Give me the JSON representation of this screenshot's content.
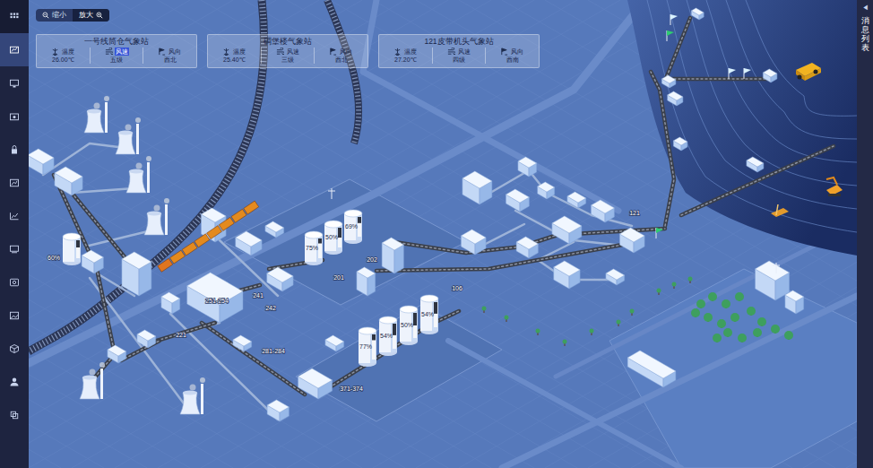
{
  "zoom_controls": [
    {
      "label": "缩小",
      "selected": false
    },
    {
      "label": "放大",
      "selected": true
    }
  ],
  "sidebar": {
    "items": [
      {
        "selected": false
      },
      {
        "selected": true
      },
      {
        "selected": false
      },
      {
        "selected": false
      },
      {
        "selected": false
      },
      {
        "selected": false
      },
      {
        "selected": false
      },
      {
        "selected": false
      },
      {
        "selected": false
      },
      {
        "selected": false
      },
      {
        "selected": false
      },
      {
        "selected": false
      },
      {
        "selected": false
      }
    ]
  },
  "weather_stations": [
    {
      "title": "一号线筒仓气象站",
      "metrics": [
        {
          "label": "温度",
          "value": "26.00℃",
          "highlighted": false
        },
        {
          "label": "风速",
          "value": "五级",
          "highlighted": true
        },
        {
          "label": "风向",
          "value": "西北",
          "highlighted": false
        }
      ]
    },
    {
      "title": "碉堡楼气象站",
      "metrics": [
        {
          "label": "温度",
          "value": "25.40℃",
          "highlighted": false
        },
        {
          "label": "风速",
          "value": "三级",
          "highlighted": false
        },
        {
          "label": "风向",
          "value": "西北",
          "highlighted": false
        }
      ]
    },
    {
      "title": "121皮带机头气象站",
      "metrics": [
        {
          "label": "温度",
          "value": "27.20℃",
          "highlighted": false
        },
        {
          "label": "风速",
          "value": "四级",
          "highlighted": false
        },
        {
          "label": "风向",
          "value": "西南",
          "highlighted": false
        }
      ]
    }
  ],
  "map": {
    "silos": [
      {
        "label": "75%",
        "level": 0.75
      },
      {
        "label": "50%",
        "level": 0.5
      },
      {
        "label": "69%",
        "level": 0.69
      },
      {
        "label": "77%",
        "level": 0.77
      },
      {
        "label": "54%",
        "level": 0.54
      },
      {
        "label": "50%",
        "level": 0.5
      },
      {
        "label": "54%",
        "level": 0.54
      },
      {
        "label": "60%",
        "level": 0.6
      }
    ],
    "labels": [
      "201",
      "202",
      "241",
      "242",
      "281-284",
      "371-374",
      "221",
      "106",
      "121",
      "251-254"
    ]
  },
  "message_panel": {
    "arrow": "◀",
    "title": "消息列表"
  }
}
